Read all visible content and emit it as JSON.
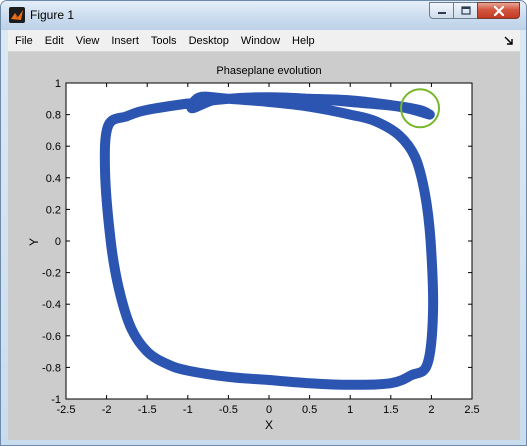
{
  "window": {
    "title": "Figure 1",
    "controls": [
      "minimize",
      "maximize",
      "close"
    ]
  },
  "menu": {
    "items": [
      "File",
      "Edit",
      "View",
      "Insert",
      "Tools",
      "Desktop",
      "Window",
      "Help"
    ]
  },
  "chart_data": {
    "type": "line",
    "title": "Phaseplane evolution",
    "xlabel": "X",
    "ylabel": "Y",
    "xlim": [
      -2.5,
      2.5
    ],
    "ylim": [
      -1,
      1
    ],
    "xticks": [
      -2.5,
      -2,
      -1.5,
      -1,
      -0.5,
      0,
      0.5,
      1,
      1.5,
      2,
      2.5
    ],
    "yticks": [
      -1,
      -0.8,
      -0.6,
      -0.4,
      -0.2,
      0,
      0.2,
      0.4,
      0.6,
      0.8,
      1
    ],
    "xtick_labels": [
      "-2.5",
      "-2",
      "-1.5",
      "-1",
      "-0.5",
      "0",
      "0.5",
      "1",
      "1.5",
      "2",
      "2.5"
    ],
    "ytick_labels": [
      "-1",
      "-0.8",
      "-0.6",
      "-0.4",
      "-0.2",
      "0",
      "0.2",
      "0.4",
      "0.6",
      "0.8",
      "1"
    ],
    "grid": false,
    "series": [
      {
        "color": "#2c55b2",
        "x": [
          1.98,
          1.6,
          1.0,
          0.5,
          0.0,
          -0.5,
          -1.0,
          -1.5,
          -1.75,
          -1.98,
          -2.02,
          -1.95,
          -1.85,
          -1.7,
          -1.5,
          -1.25,
          -1.0,
          -0.5,
          0.0,
          0.5,
          1.0,
          1.5,
          1.75,
          1.95,
          2.02,
          1.99,
          1.92,
          1.8,
          1.6,
          1.3,
          1.0,
          0.5,
          0.0,
          -0.5,
          -0.85,
          -0.95,
          -0.7,
          -0.5,
          0.0,
          0.5,
          1.0,
          1.5,
          1.85,
          1.98
        ],
        "y": [
          0.8,
          0.85,
          0.88,
          0.9,
          0.91,
          0.9,
          0.87,
          0.83,
          0.79,
          0.73,
          0.45,
          0.0,
          -0.3,
          -0.55,
          -0.7,
          -0.78,
          -0.82,
          -0.86,
          -0.88,
          -0.9,
          -0.91,
          -0.9,
          -0.85,
          -0.78,
          -0.45,
          0.0,
          0.3,
          0.53,
          0.67,
          0.76,
          0.8,
          0.85,
          0.88,
          0.9,
          0.91,
          0.84,
          0.89,
          0.9,
          0.91,
          0.9,
          0.89,
          0.86,
          0.83,
          0.8
        ]
      }
    ],
    "annotation": {
      "shape": "circle",
      "color": "#76b82a",
      "x": 1.86,
      "y": 0.84
    }
  }
}
